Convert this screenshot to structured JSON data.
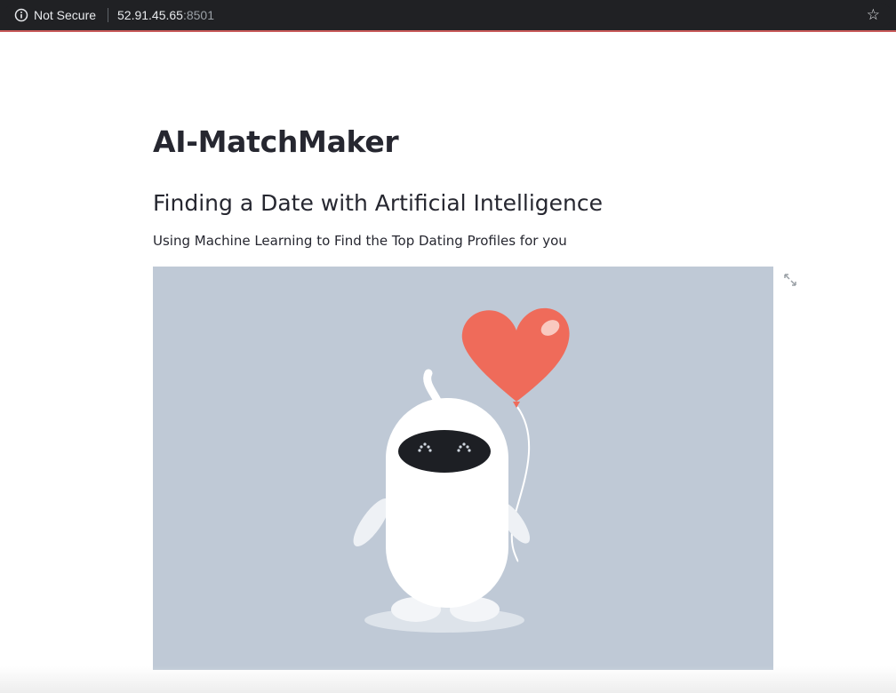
{
  "browser": {
    "security_label": "Not Secure",
    "url_host": "52.91.45.65",
    "url_port": ":8501",
    "icons": [
      "info-icon",
      "star-icon"
    ]
  },
  "page": {
    "title": "AI-MatchMaker",
    "subtitle": "Finding a Date with Artificial Intelligence",
    "description": "Using Machine Learning to Find the Top Dating Profiles for you"
  },
  "hero_image": {
    "subject": "robot-holding-heart-balloon",
    "colors": {
      "background": "#bfc9d6",
      "heart": "#ef6b5a",
      "robot": "#ffffff",
      "visor": "#1d1f24"
    }
  },
  "icons": [
    "fullscreen-icon"
  ]
}
